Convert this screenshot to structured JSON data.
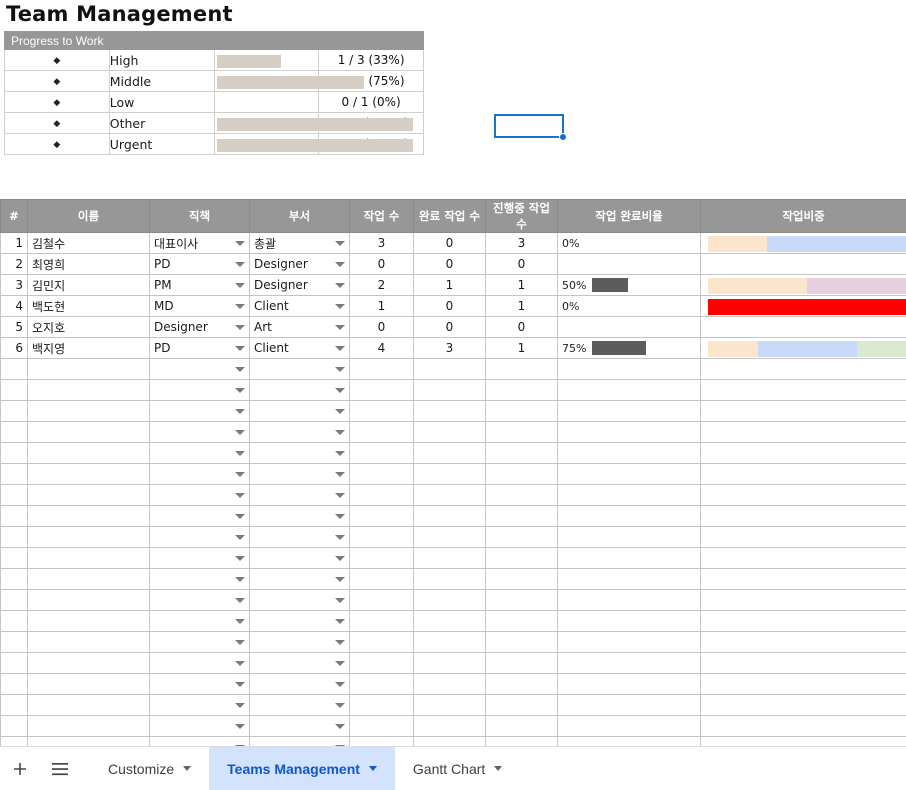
{
  "title": "Team Management",
  "progress_panel": {
    "header": "Progress to Work",
    "bullet": "◆",
    "rows": [
      {
        "label": "High",
        "value": "1 / 3 (33%)",
        "percent": 33
      },
      {
        "label": "Middle",
        "value": "3 / 4 (75%)",
        "percent": 75
      },
      {
        "label": "Low",
        "value": "0 / 1 (0%)",
        "percent": 0
      },
      {
        "label": "Other",
        "value": "1 / 1 (100%)",
        "percent": 100
      },
      {
        "label": "Urgent",
        "value": "1 / 1 (100%)",
        "percent": 100
      }
    ]
  },
  "grid": {
    "headers": [
      "#",
      "이름",
      "직책",
      "부서",
      "작업 수",
      "완료 작업 수",
      "진행중 작업 수",
      "작업 완료비율",
      "작업비중"
    ],
    "rows": [
      {
        "num": "1",
        "name": "김철수",
        "position": "대표이사",
        "department": "총괄",
        "tasks": "3",
        "done": "0",
        "progress": "3",
        "rate_label": "0%",
        "rate_percent": 0,
        "weight": [
          {
            "percent": 30,
            "color": "#fce5cd"
          },
          {
            "percent": 70,
            "color": "#c9daf8"
          }
        ]
      },
      {
        "num": "2",
        "name": "최영희",
        "position": "PD",
        "department": "Designer",
        "tasks": "0",
        "done": "0",
        "progress": "0",
        "rate_label": "",
        "rate_percent": 0,
        "weight": []
      },
      {
        "num": "3",
        "name": "김민지",
        "position": "PM",
        "department": "Designer",
        "tasks": "2",
        "done": "1",
        "progress": "1",
        "rate_label": "50%",
        "rate_percent": 50,
        "weight": [
          {
            "percent": 50,
            "color": "#fce5cd"
          },
          {
            "percent": 50,
            "color": "#e6d0dd"
          }
        ]
      },
      {
        "num": "4",
        "name": "백도현",
        "position": "MD",
        "department": "Client",
        "tasks": "1",
        "done": "0",
        "progress": "1",
        "rate_label": "0%",
        "rate_percent": 0,
        "weight": [
          {
            "percent": 100,
            "color": "#ff0000"
          }
        ]
      },
      {
        "num": "5",
        "name": "오지호",
        "position": "Designer",
        "department": "Art",
        "tasks": "0",
        "done": "0",
        "progress": "0",
        "rate_label": "",
        "rate_percent": 0,
        "weight": []
      },
      {
        "num": "6",
        "name": "백지영",
        "position": "PD",
        "department": "Client",
        "tasks": "4",
        "done": "3",
        "progress": "1",
        "rate_label": "75%",
        "rate_percent": 75,
        "weight": [
          {
            "percent": 25,
            "color": "#fce5cd"
          },
          {
            "percent": 50,
            "color": "#c9daf8"
          },
          {
            "percent": 25,
            "color": "#d9ead3"
          }
        ]
      }
    ],
    "empty_row_count": 19
  },
  "tabbar": {
    "add_sheet_icon": "plus-icon",
    "all_sheets_icon": "hamburger-menu-icon",
    "tabs": [
      {
        "label": "Customize",
        "active": false
      },
      {
        "label": "Teams Management",
        "active": true
      },
      {
        "label": "Gantt Chart",
        "active": false
      }
    ]
  },
  "colors": {
    "header_gray": "#979797",
    "progress_bar": "#d6cdc5",
    "rate_bar": "#5c5c5c",
    "selection_blue": "#1a73c7",
    "active_tab_bg": "#d3e3fd",
    "active_tab_text": "#0b57d0"
  }
}
